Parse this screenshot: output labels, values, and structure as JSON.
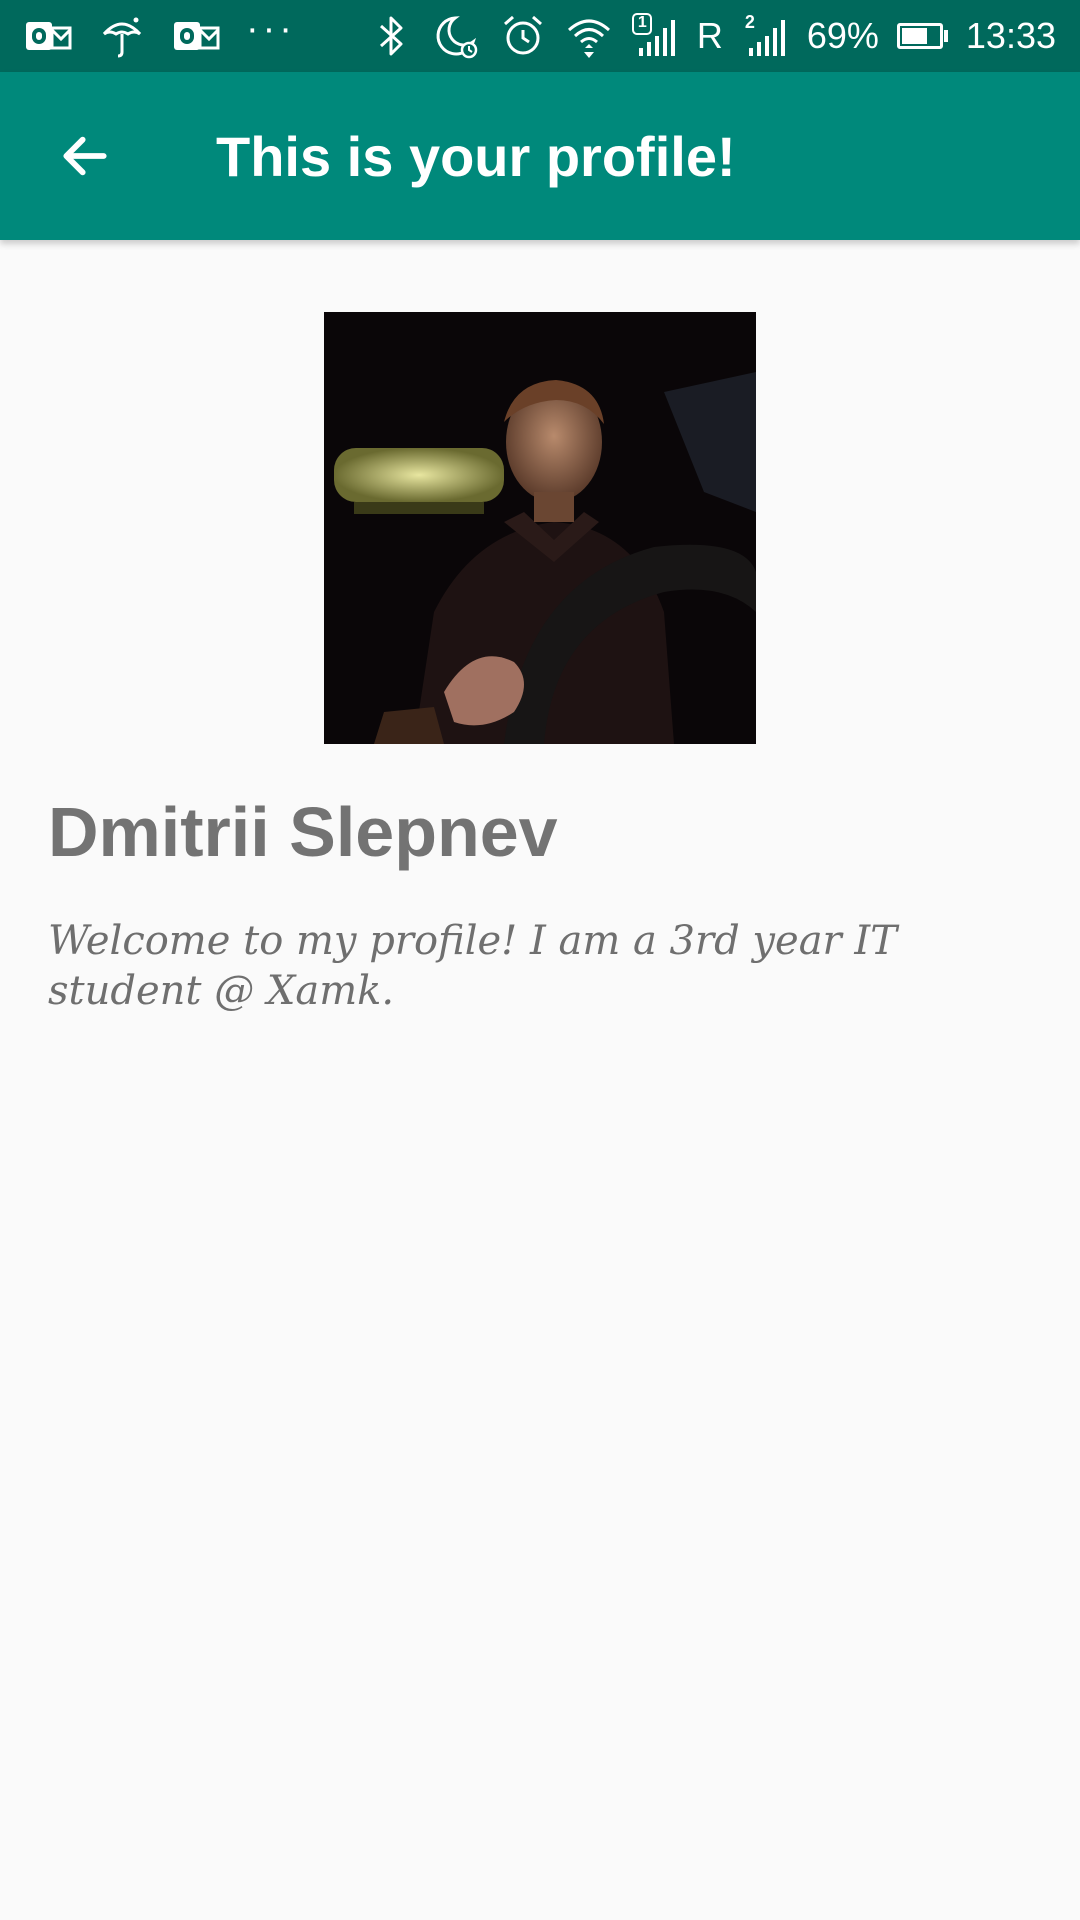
{
  "status_bar": {
    "left_icons": [
      "outlook-icon",
      "umbrella-icon",
      "outlook-icon",
      "more-dots-icon"
    ],
    "more_dots": "···",
    "sim1_label": "1",
    "roaming_label": "R",
    "sim2_label": "2",
    "battery_percent_text": "69%",
    "battery_level": 0.69,
    "time": "13:33",
    "background_color": "#00695c"
  },
  "app_bar": {
    "title": "This is your profile!",
    "back_icon": "arrow-back-icon",
    "background_color": "#00897b"
  },
  "profile": {
    "name": "Dmitrii Slepnev",
    "bio": "Welcome to my profile! I am a 3rd year IT student @ Xamk.",
    "avatar": "profile-photo"
  }
}
